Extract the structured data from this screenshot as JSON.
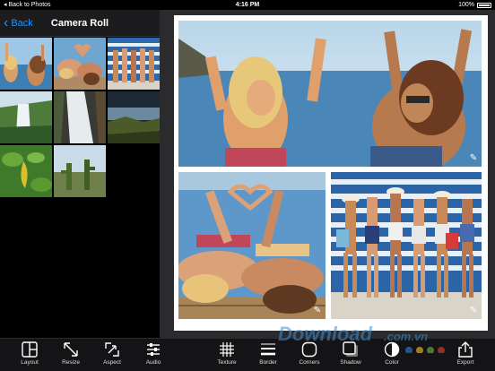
{
  "status_bar": {
    "back_to_app": "Back to Photos",
    "time": "4:16 PM",
    "battery_percent": "100%"
  },
  "sidebar": {
    "back_label": "Back",
    "title": "Camera Roll",
    "thumbnails": [
      {
        "name": "thumb-girls-beach-1",
        "kind": "beach-girls"
      },
      {
        "name": "thumb-girls-heart",
        "kind": "beach-girls-2"
      },
      {
        "name": "thumb-girls-stripes",
        "kind": "stripes"
      },
      {
        "name": "thumb-waterfall",
        "kind": "waterfall"
      },
      {
        "name": "thumb-waterfall-2",
        "kind": "waterfall-2"
      },
      {
        "name": "thumb-coast",
        "kind": "coast"
      },
      {
        "name": "thumb-pepper",
        "kind": "pepper"
      },
      {
        "name": "thumb-cactus",
        "kind": "cactus"
      }
    ]
  },
  "toolbar": {
    "items": [
      {
        "label": "Layout",
        "icon": "layout-icon"
      },
      {
        "label": "Resize",
        "icon": "resize-icon"
      },
      {
        "label": "Aspect",
        "icon": "aspect-icon"
      },
      {
        "label": "Audio",
        "icon": "audio-icon"
      },
      {
        "label": "Texture",
        "icon": "texture-icon"
      },
      {
        "label": "Border",
        "icon": "border-icon"
      },
      {
        "label": "Corners",
        "icon": "corners-icon"
      },
      {
        "label": "Shadow",
        "icon": "shadow-icon"
      },
      {
        "label": "Color",
        "icon": "color-icon"
      },
      {
        "label": "Export",
        "icon": "export-icon"
      }
    ]
  },
  "watermark": {
    "text": "Download",
    "suffix": ".com.vn"
  },
  "colors": {
    "accent": "#1e90ff",
    "panel": "#1c1c1e",
    "canvas_bg": "#2b2b2d"
  }
}
